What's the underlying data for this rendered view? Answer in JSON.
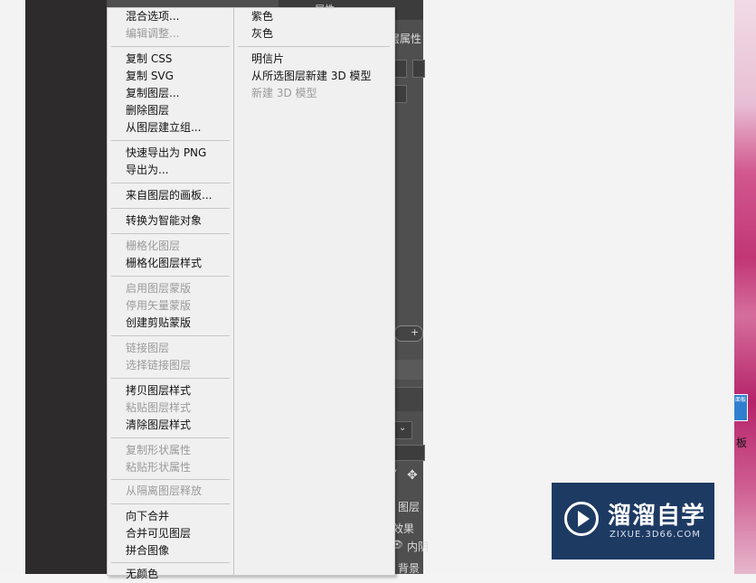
{
  "context_menu": {
    "col1": [
      {
        "label": "混合选项...",
        "disabled": false
      },
      {
        "label": "编辑调整...",
        "disabled": true
      },
      {
        "label": "复制 CSS",
        "disabled": false
      },
      {
        "label": "复制 SVG",
        "disabled": false
      },
      {
        "label": "复制图层...",
        "disabled": false
      },
      {
        "label": "删除图层",
        "disabled": false
      },
      {
        "label": "从图层建立组...",
        "disabled": false
      },
      {
        "label": "快速导出为 PNG",
        "disabled": false
      },
      {
        "label": "导出为...",
        "disabled": false
      },
      {
        "label": "来自图层的画板...",
        "disabled": false
      },
      {
        "label": "转换为智能对象",
        "disabled": false
      },
      {
        "label": "栅格化图层",
        "disabled": true
      },
      {
        "label": "栅格化图层样式",
        "disabled": false
      },
      {
        "label": "启用图层蒙版",
        "disabled": true
      },
      {
        "label": "停用矢量蒙版",
        "disabled": true
      },
      {
        "label": "创建剪贴蒙版",
        "disabled": false
      },
      {
        "label": "链接图层",
        "disabled": true
      },
      {
        "label": "选择链接图层",
        "disabled": true
      },
      {
        "label": "拷贝图层样式",
        "disabled": false
      },
      {
        "label": "粘贴图层样式",
        "disabled": true
      },
      {
        "label": "清除图层样式",
        "disabled": false
      },
      {
        "label": "复制形状属性",
        "disabled": true
      },
      {
        "label": "粘贴形状属性",
        "disabled": true
      },
      {
        "label": "从隔离图层释放",
        "disabled": true
      },
      {
        "label": "向下合并",
        "disabled": false
      },
      {
        "label": "合并可见图层",
        "disabled": false
      },
      {
        "label": "拼合图像",
        "disabled": false
      },
      {
        "label": "无颜色",
        "disabled": false
      }
    ],
    "col2": [
      {
        "label": "紫色",
        "disabled": false
      },
      {
        "label": "灰色",
        "disabled": false
      },
      {
        "label": "明信片",
        "disabled": false
      },
      {
        "label": "从所选图层新建 3D 模型",
        "disabled": false
      },
      {
        "label": "新建 3D 模型",
        "disabled": true
      }
    ]
  },
  "panel": {
    "layer_props_label": "层属性",
    "top_tab": "属性",
    "add_symbol": "+",
    "layers_title": "图层",
    "effects_label": "效果",
    "inner_label": "内阴",
    "background_label": "背景",
    "eye_icon": "eye-icon",
    "move_icon": "move-icon",
    "brush_icon": "brush-icon"
  },
  "right_edge": {
    "tab_text": "面板",
    "side_label": "板"
  },
  "watermark": {
    "title": "溜溜自学",
    "subtitle": "ZIXUE.3D66.COM",
    "colors": {
      "bg": "#1d3a63",
      "fg": "#ffffff"
    }
  }
}
